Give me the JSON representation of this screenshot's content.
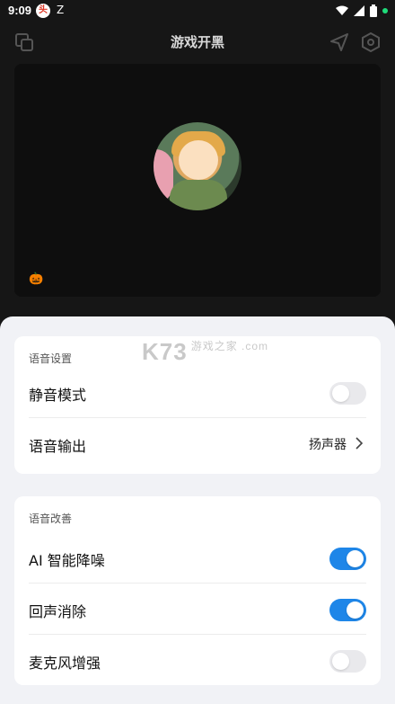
{
  "status": {
    "time": "9:09",
    "notif1": "头",
    "notif2": "Z"
  },
  "header": {
    "title": "游戏开黑"
  },
  "room": {
    "badge": "🎃"
  },
  "watermark": {
    "brand": "K73",
    "sub": "游戏之家 .com"
  },
  "voice_settings": {
    "section_title": "语音设置",
    "mute_label": "静音模式",
    "mute_on": false,
    "output_label": "语音输出",
    "output_value": "扬声器"
  },
  "voice_improve": {
    "section_title": "语音改善",
    "items": [
      {
        "label": "AI 智能降噪",
        "on": true
      },
      {
        "label": "回声消除",
        "on": true
      },
      {
        "label": "麦克风增强",
        "on": false
      }
    ]
  },
  "colors": {
    "accent": "#1e86e8",
    "toggle_off": "#e9e9ec"
  }
}
